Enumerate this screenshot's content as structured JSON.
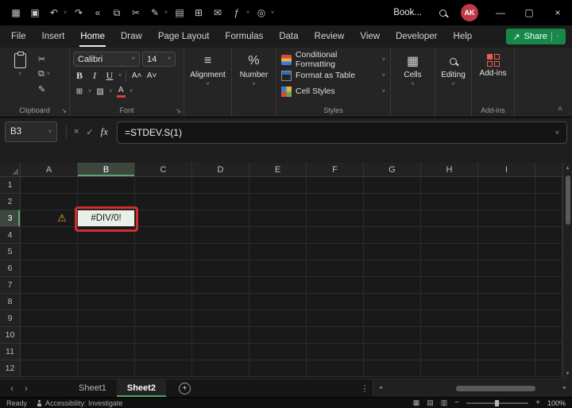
{
  "icons": {
    "menu_grid": "▦",
    "save": "▣",
    "undo": "↶",
    "redo": "↷",
    "collapse_left": "«",
    "copy": "⧉",
    "cut": "✂",
    "format_painter": "✎",
    "printer": "▤",
    "table": "⊞",
    "mail": "✉",
    "function": "ƒ",
    "record": "◎",
    "flag": "⚑",
    "chevron_down": "˅",
    "chevron_up": "˄",
    "minimize": "—",
    "maximize": "▢",
    "close": "×",
    "bold": "B",
    "italic": "I",
    "underline": "U",
    "grow_font": "A˄",
    "shrink_font": "A˅",
    "borders": "⊞",
    "fill_color": "▨",
    "font_color": "A",
    "align": "≡",
    "percent": "%",
    "cells": "▦",
    "cancel": "×",
    "enter": "✓",
    "fx": "fx",
    "warning": "⚠",
    "nav_left": "‹",
    "nav_right": "›",
    "plus": "+",
    "ellipsis": "⋮",
    "scroll_up": "▲",
    "scroll_down": "▼",
    "scroll_left": "◄",
    "scroll_right": "►",
    "minus": "−",
    "share_arrow": "↗",
    "view_normal": "▦",
    "view_layout": "▤",
    "view_break": "▥"
  },
  "colors": {
    "share_green": "#15884a",
    "selection_green": "#58a86e",
    "annotation_red": "#d22d2d",
    "avatar_red": "#c0394b",
    "warning_orange": "#e9a13b",
    "error_cell_fill": "#e9f1e6",
    "font_color_red": "#e03c31",
    "addins_red": "#e8604c"
  },
  "titlebar": {
    "title": "Book...",
    "avatar": "AK",
    "quick_access": [
      {
        "name": "menu-grid",
        "icon": "menu_grid"
      },
      {
        "name": "save",
        "icon": "save"
      },
      {
        "name": "undo",
        "icon": "undo",
        "chevron": true
      },
      {
        "name": "redo",
        "icon": "redo"
      },
      {
        "name": "collapse-toolbar",
        "icon": "collapse_left"
      },
      {
        "name": "copy",
        "icon": "copy"
      },
      {
        "name": "cut",
        "icon": "cut"
      },
      {
        "name": "format-painter",
        "icon": "format_painter",
        "chevron": true
      },
      {
        "name": "printer",
        "icon": "printer"
      },
      {
        "name": "table",
        "icon": "table"
      },
      {
        "name": "mail",
        "icon": "mail"
      },
      {
        "name": "draw-function",
        "icon": "function",
        "chevron": true
      },
      {
        "name": "record-macro",
        "icon": "record",
        "chevron": true
      }
    ]
  },
  "ribbon": {
    "tabs": [
      "File",
      "Insert",
      "Home",
      "Draw",
      "Page Layout",
      "Formulas",
      "Data",
      "Review",
      "View",
      "Developer",
      "Help"
    ],
    "active_tab": "Home",
    "share_label": "Share",
    "groups": {
      "clipboard": {
        "label": "Clipboard"
      },
      "font": {
        "label": "Font",
        "font_name": "Calibri",
        "font_size": "14"
      },
      "alignment": {
        "label": "Alignment"
      },
      "number": {
        "label": "Number"
      },
      "styles": {
        "label": "Styles",
        "items": [
          "Conditional Formatting",
          "Format as Table",
          "Cell Styles"
        ]
      },
      "cells": {
        "label": "Cells"
      },
      "editing": {
        "label": "Editing"
      },
      "addins": {
        "button_label": "Add-ins",
        "label": "Add-ins"
      }
    }
  },
  "formula_bar": {
    "name_box": "B3",
    "formula": "=STDEV.S(1)"
  },
  "grid": {
    "columns": [
      "A",
      "B",
      "C",
      "D",
      "E",
      "F",
      "G",
      "H",
      "I"
    ],
    "rows": [
      "1",
      "2",
      "3",
      "4",
      "5",
      "6",
      "7",
      "8",
      "9",
      "10",
      "11",
      "12"
    ],
    "selected_column": "B",
    "selected_row": "3",
    "active_cell": {
      "ref": "B3",
      "value": "#DIV/0!"
    }
  },
  "sheet_bar": {
    "tabs": [
      "Sheet1",
      "Sheet2"
    ],
    "active": "Sheet2"
  },
  "status_bar": {
    "mode": "Ready",
    "accessibility": "Accessibility: Investigate",
    "zoom": "100%"
  }
}
